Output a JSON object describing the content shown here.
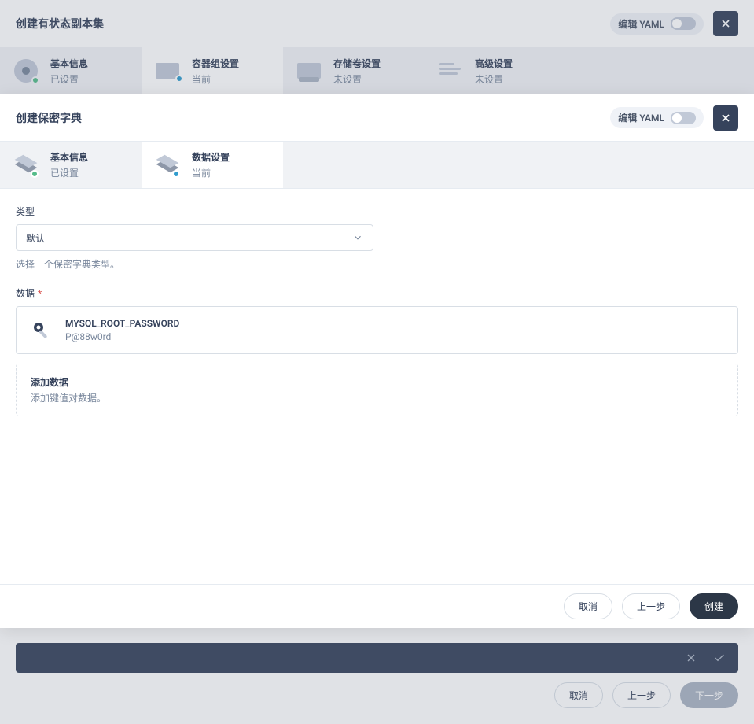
{
  "bg": {
    "title": "创建有状态副本集",
    "yaml_label": "编辑 YAML",
    "tabs": [
      {
        "title": "基本信息",
        "subtitle": "已设置"
      },
      {
        "title": "容器组设置",
        "subtitle": "当前"
      },
      {
        "title": "存储卷设置",
        "subtitle": "未设置"
      },
      {
        "title": "高级设置",
        "subtitle": "未设置"
      }
    ],
    "buttons": {
      "cancel": "取消",
      "prev": "上一步",
      "next": "下一步"
    }
  },
  "modal": {
    "title": "创建保密字典",
    "yaml_label": "编辑 YAML",
    "tabs": [
      {
        "title": "基本信息",
        "subtitle": "已设置"
      },
      {
        "title": "数据设置",
        "subtitle": "当前"
      }
    ],
    "type": {
      "label": "类型",
      "value": "默认",
      "hint": "选择一个保密字典类型。"
    },
    "data": {
      "label": "数据",
      "items": [
        {
          "key": "MYSQL_ROOT_PASSWORD",
          "value": "P@88w0rd"
        }
      ],
      "add_title": "添加数据",
      "add_hint": "添加键值对数据。"
    },
    "buttons": {
      "cancel": "取消",
      "prev": "上一步",
      "create": "创建"
    }
  }
}
